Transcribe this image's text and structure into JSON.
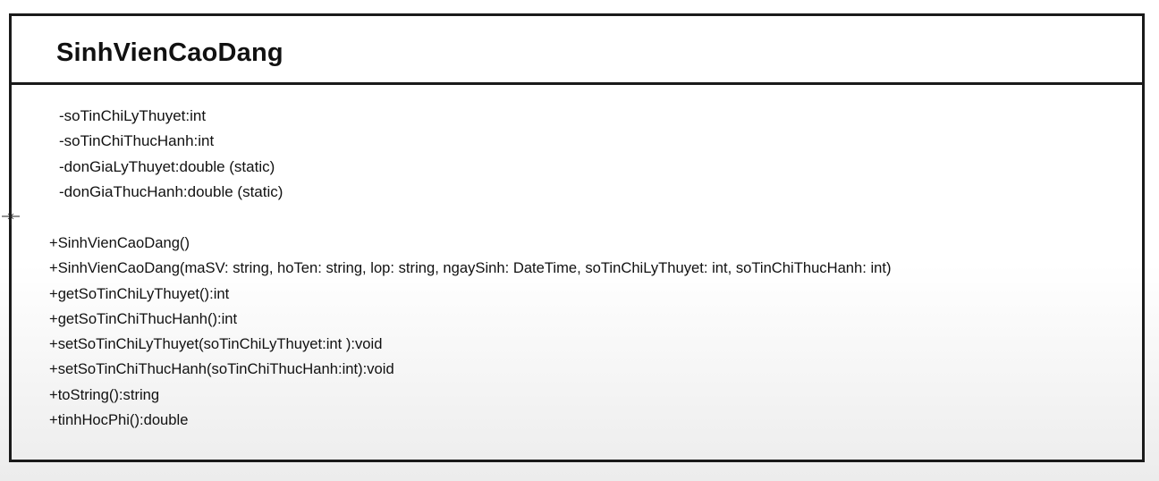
{
  "class_name": "SinhVienCaoDang",
  "attributes": [
    "-soTinChiLyThuyet:int",
    "-soTinChiThucHanh:int",
    "-donGiaLyThuyet:double (static)",
    "-donGiaThucHanh:double (static)"
  ],
  "methods": [
    "+SinhVienCaoDang()",
    "+SinhVienCaoDang(maSV: string, hoTen: string, lop: string, ngaySinh: DateTime, soTinChiLyThuyet: int, soTinChiThucHanh: int)",
    "+getSoTinChiLyThuyet():int",
    "+getSoTinChiThucHanh():int",
    "+setSoTinChiLyThuyet(soTinChiLyThuyet:int ):void",
    "+setSoTinChiThucHanh(soTinChiThucHanh:int):void",
    "+toString():string",
    "+tinhHocPhi():double"
  ],
  "cursor_icon": "crosshair-cursor-icon"
}
